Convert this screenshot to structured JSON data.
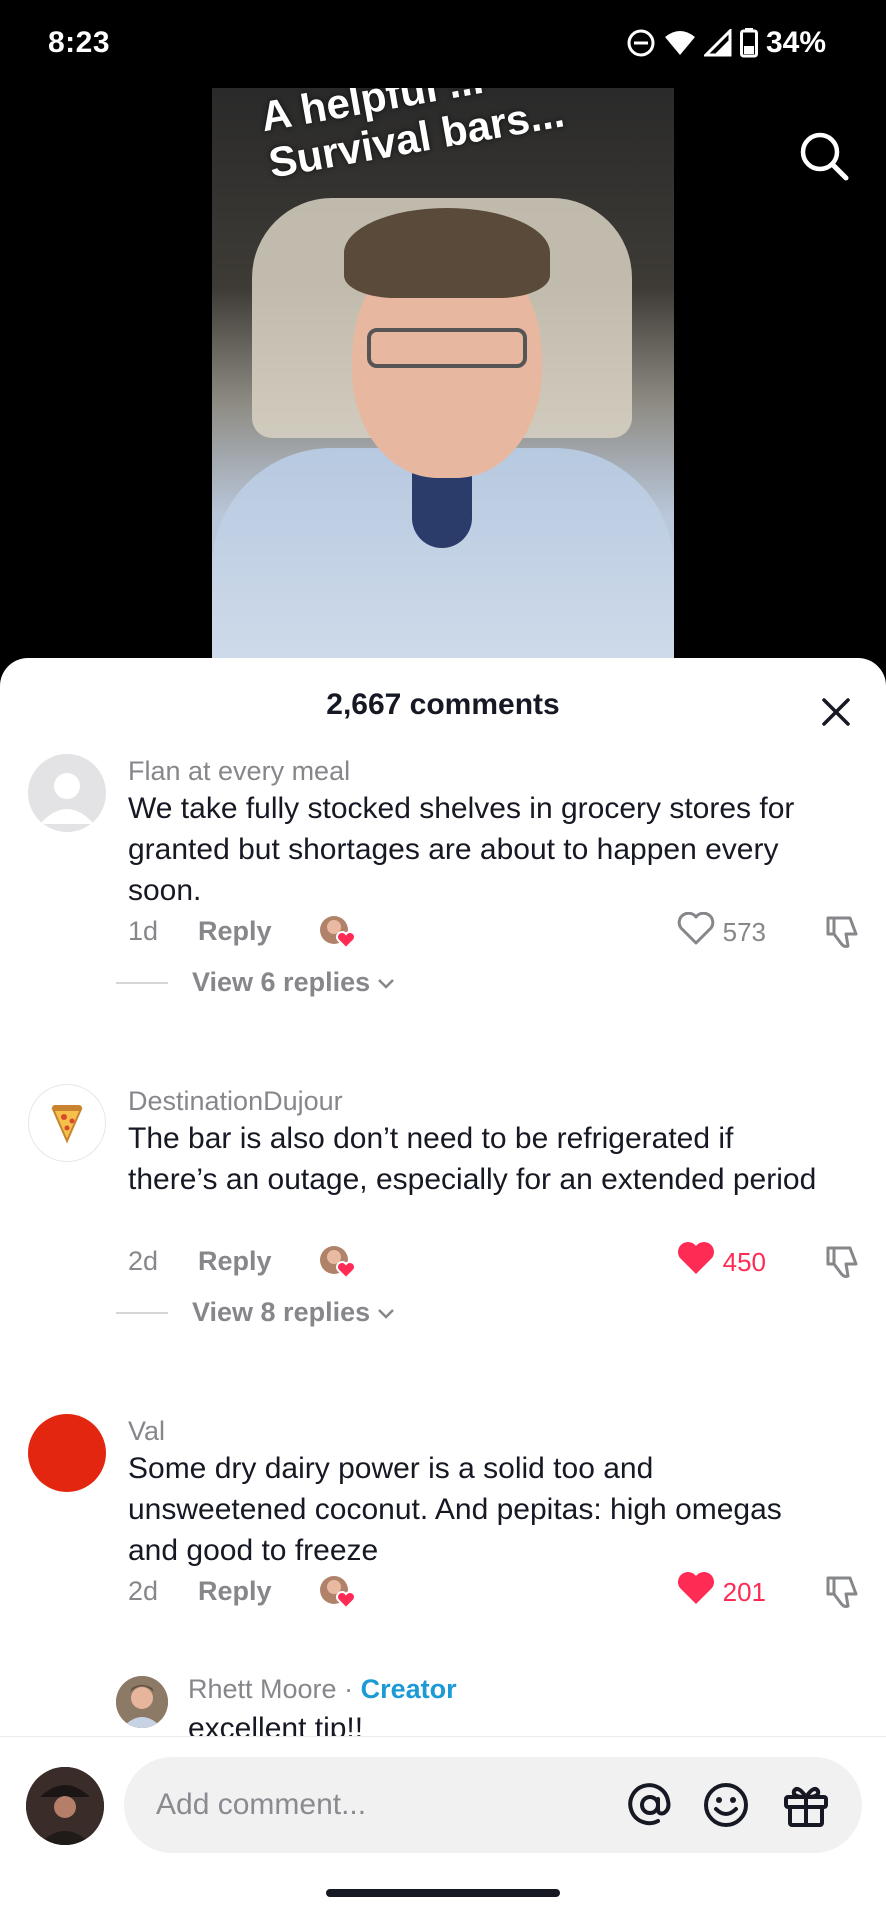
{
  "status_bar": {
    "time": "8:23",
    "battery": "34%",
    "icons": [
      "do-not-disturb-icon",
      "wifi-icon",
      "signal-icon",
      "battery-icon"
    ]
  },
  "video": {
    "caption_line1": "A helpful ...",
    "caption_line2": "Survival bars..."
  },
  "sheet": {
    "title": "2,667 comments"
  },
  "comments": [
    {
      "username": "Flan at every meal",
      "text": "We take fully stocked shelves in grocery stores for granted but shortages are about to happen every soon.",
      "time": "1d",
      "reply_label": "Reply",
      "likes": "573",
      "liked": false,
      "view_replies": "View 6 replies"
    },
    {
      "username": "DestinationDujour",
      "text": "The bar is also don’t need to be refrigerated if there’s an outage, especially for an extended period",
      "time": "2d",
      "reply_label": "Reply",
      "likes": "450",
      "liked": true,
      "view_replies": "View 8 replies"
    },
    {
      "username": "Val",
      "text": "Some dry dairy power is a solid too and unsweetened coconut. And pepitas: high omegas and good to freeze",
      "time": "2d",
      "reply_label": "Reply",
      "likes": "201",
      "liked": true
    }
  ],
  "creator_reply": {
    "username": "Rhett Moore",
    "separator": " · ",
    "tag": "Creator",
    "text": "excellent tip!!"
  },
  "composer": {
    "placeholder": "Add comment..."
  },
  "colors": {
    "accent_red": "#fe2c55",
    "creator_blue": "#1c9ad6",
    "muted_text": "#86878b"
  }
}
